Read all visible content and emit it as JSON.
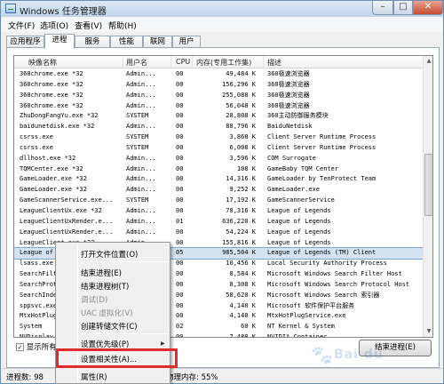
{
  "window": {
    "title": "Windows 任务管理器"
  },
  "titlebar_buttons": {
    "minimize": "–",
    "maximize": "□",
    "close": "✕"
  },
  "menubar": [
    {
      "label": "文件(F)"
    },
    {
      "label": "选项(O)"
    },
    {
      "label": "查看(V)"
    },
    {
      "label": "帮助(H)"
    }
  ],
  "tabs": [
    {
      "label": "应用程序",
      "active": false
    },
    {
      "label": "进程",
      "active": true
    },
    {
      "label": "服务",
      "active": false
    },
    {
      "label": "性能",
      "active": false
    },
    {
      "label": "联网",
      "active": false
    },
    {
      "label": "用户",
      "active": false
    }
  ],
  "columns": {
    "name": "映像名称",
    "user": "用户名",
    "cpu": "CPU",
    "mem": "内存(专用工作集)",
    "desc": "描述"
  },
  "rows": [
    {
      "name": "360chrome.exe *32",
      "user": "Admin...",
      "cpu": "00",
      "mem": "49,484 K",
      "desc": "360极速浏览器"
    },
    {
      "name": "360chrome.exe *32",
      "user": "Admin...",
      "cpu": "00",
      "mem": "156,296 K",
      "desc": "360极速浏览器"
    },
    {
      "name": "360chrome.exe *32",
      "user": "Admin...",
      "cpu": "00",
      "mem": "255,088 K",
      "desc": "360极速浏览器"
    },
    {
      "name": "360chrome.exe *32",
      "user": "Admin...",
      "cpu": "00",
      "mem": "56,048 K",
      "desc": "360极速浏览器"
    },
    {
      "name": "ZhuDongFangYu.exe *32",
      "user": "SYSTEM",
      "cpu": "00",
      "mem": "28,808 K",
      "desc": "360主动防御服务模块"
    },
    {
      "name": "baidunetdisk.exe *32",
      "user": "Admin...",
      "cpu": "00",
      "mem": "88,796 K",
      "desc": "BaiduNetdisk"
    },
    {
      "name": "csrss.exe",
      "user": "SYSTEM",
      "cpu": "00",
      "mem": "3,868 K",
      "desc": "Client Server Runtime Process"
    },
    {
      "name": "csrss.exe",
      "user": "SYSTEM",
      "cpu": "00",
      "mem": "6,008 K",
      "desc": "Client Server Runtime Process"
    },
    {
      "name": "dllhost.exe *32",
      "user": "Admin...",
      "cpu": "00",
      "mem": "3,596 K",
      "desc": "COM Surrogate"
    },
    {
      "name": "TQMCenter.exe *32",
      "user": "Admin...",
      "cpu": "00",
      "mem": "108 K",
      "desc": "GameBaby TQM Center"
    },
    {
      "name": "GameLoader.exe *32",
      "user": "Admin...",
      "cpu": "00",
      "mem": "14,316 K",
      "desc": "GameLoader by TenProtect Team"
    },
    {
      "name": "GameLoader.exe *32",
      "user": "Admin...",
      "cpu": "00",
      "mem": "9,252 K",
      "desc": "GameLoader.exe"
    },
    {
      "name": "GameScannerService.exe...",
      "user": "SYSTEM",
      "cpu": "00",
      "mem": "17,192 K",
      "desc": "GameScannerService"
    },
    {
      "name": "LeagueClientUx.exe *32",
      "user": "Admin...",
      "cpu": "00",
      "mem": "78,316 K",
      "desc": "League of Legends"
    },
    {
      "name": "LeagueClientUxRender.e...",
      "user": "Admin...",
      "cpu": "01",
      "mem": "636,220 K",
      "desc": "League of Legends"
    },
    {
      "name": "LeagueClientUxRender.e...",
      "user": "Admin...",
      "cpu": "00",
      "mem": "54,224 K",
      "desc": "League of Legends"
    },
    {
      "name": "LeagueClient.exe *32",
      "user": "Admin...",
      "cpu": "00",
      "mem": "155,816 K",
      "desc": "League of Legends"
    },
    {
      "name": "League of Legends.exe *32",
      "user": "Admin...",
      "cpu": "05",
      "mem": "985,504 K",
      "desc": "League of Legends (TM) Client",
      "selected": true
    },
    {
      "name": "lsass.exe",
      "user": "",
      "cpu": "00",
      "mem": "10,456 K",
      "desc": "Local Security Authority Process"
    },
    {
      "name": "SearchFilte",
      "user": "",
      "cpu": "00",
      "mem": "8,584 K",
      "desc": "Microsoft Windows Search Filter Host"
    },
    {
      "name": "SearchProtoc",
      "user": "",
      "cpu": "00",
      "mem": "8,308 K",
      "desc": "Microsoft Windows Search Protocol Host"
    },
    {
      "name": "SearchIndex",
      "user": "",
      "cpu": "00",
      "mem": "58,620 K",
      "desc": "Microsoft Windows Search 索引器"
    },
    {
      "name": "sppsvc.exe",
      "user": "",
      "cpu": "00",
      "mem": "4,140 K",
      "desc": "Microsoft 软件保护平台服务"
    },
    {
      "name": "MtxHotPlugS",
      "user": "",
      "cpu": "00",
      "mem": "4,140 K",
      "desc": "MtxHotPlugService.exe"
    },
    {
      "name": "System",
      "user": "",
      "cpu": "02",
      "mem": "60 K",
      "desc": "NT Kernel & System"
    },
    {
      "name": "NVDisplay.C",
      "user": "",
      "cpu": "00",
      "mem": "7,488 K",
      "desc": "NVIDIA Container"
    }
  ],
  "show_all_label": "显示所有用",
  "show_all_checked": true,
  "end_process_label": "结束进程(E)",
  "status": {
    "processes": "进程数: 98",
    "memory": "物理内存: 55%"
  },
  "context_menu": [
    {
      "label": "打开文件位置(O)",
      "disabled": false
    },
    {
      "label": "结束进程(E)",
      "disabled": false
    },
    {
      "label": "结束进程树(T)",
      "disabled": false
    },
    {
      "label": "调试(D)",
      "disabled": true
    },
    {
      "label": "UAC 虚拟化(V)",
      "disabled": true
    },
    {
      "label": "创建转储文件(C)",
      "disabled": false
    },
    {
      "label": "设置优先级(P)",
      "disabled": false,
      "submenu": true
    },
    {
      "label": "设置相关性(A)...",
      "disabled": false
    },
    {
      "label": "属性(R)",
      "disabled": false
    }
  ],
  "colors": {
    "highlight": "#e22a2a",
    "selection": "#d4e2f2"
  },
  "icons": {
    "app": "task-manager-icon",
    "submenu": "chevron-right-icon",
    "scroll_up": "arrow-up-icon",
    "scroll_down": "arrow-down-icon"
  }
}
